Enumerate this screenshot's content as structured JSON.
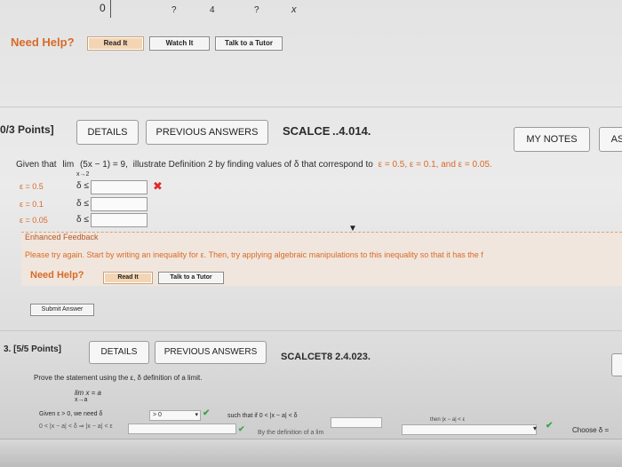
{
  "top_strip": {
    "items": [
      "0",
      "?",
      "4",
      "?",
      "x"
    ]
  },
  "help_top": {
    "label": "Need Help?",
    "read": "Read It",
    "watch": "Watch It",
    "talk": "Talk to a Tutor"
  },
  "problem1": {
    "points": "0/3 Points]",
    "details": "DETAILS",
    "previous": "PREVIOUS ANSWERS",
    "code": "SCALCE ..4.014.",
    "my_notes": "MY NOTES",
    "ask": "AS",
    "question_prefix": "Given that",
    "lim": "lim",
    "lim_sub": "x→2",
    "question_expr": "(5x − 1) = 9,",
    "question_body": "illustrate Definition 2 by finding values of δ that correspond to",
    "eps_values": "ε = 0.5, ε = 0.1, and ε = 0.05.",
    "rows": [
      {
        "eps": "ε = 0.5",
        "delta": "δ ≤",
        "mark": "✖"
      },
      {
        "eps": "ε = 0.1",
        "delta": "δ ≤",
        "mark": ""
      },
      {
        "eps": "ε = 0.05",
        "delta": "δ ≤",
        "mark": ""
      }
    ],
    "feedback_title": "Enhanced Feedback",
    "feedback_text": "Please try again. Start by writing an inequality for ε. Then, try applying algebraic manipulations to this inequality so that it has the f",
    "help_label": "Need Help?",
    "help_read": "Read It",
    "help_talk": "Talk to a Tutor",
    "submit": "Submit Answer"
  },
  "problem2": {
    "points": "3.  [5/5 Points]",
    "details": "DETAILS",
    "previous": "PREVIOUS ANSWERS",
    "code": "SCALCET8 2.4.023.",
    "prompt": "Prove the statement using the ε, δ definition of a limit.",
    "lim": "lim  x = a",
    "lim_sub": "x→a",
    "given": "Given ε > 0, we need δ",
    "dd1": "> 0",
    "such_that": "such that if  0 < |x − a| < δ",
    "then": "then |x − a| < ε",
    "choose": "Choose δ =",
    "row2a": "0 < |x − a| < δ  ⇒  |x − a| < ε",
    "row2b": "By the definition of a lim"
  }
}
